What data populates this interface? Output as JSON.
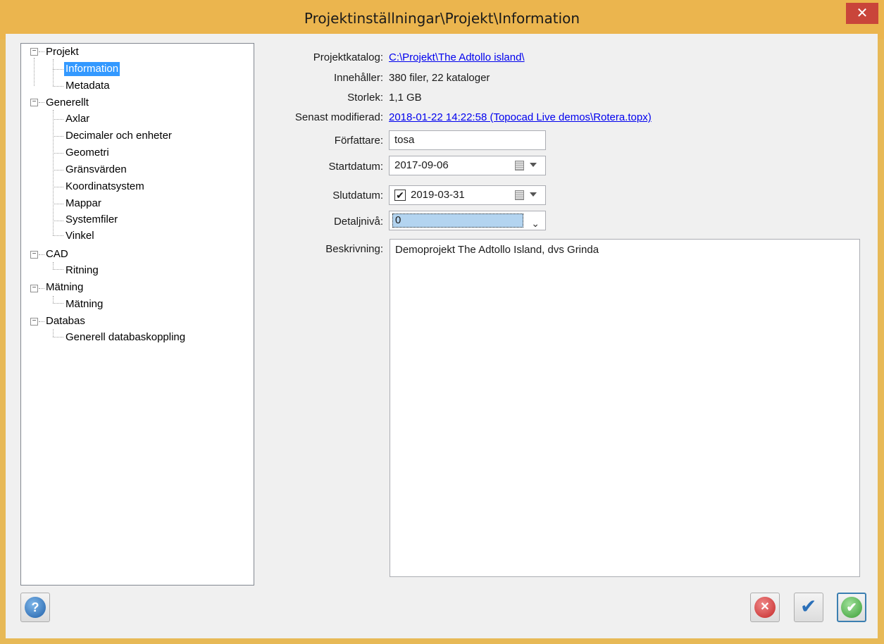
{
  "window": {
    "title": "Projektinställningar\\Projekt\\Information",
    "close_label": "✕"
  },
  "tree": {
    "nodes": [
      {
        "label": "Projekt",
        "level": 0,
        "expanded": true
      },
      {
        "label": "Information",
        "level": 1,
        "selected": true
      },
      {
        "label": "Metadata",
        "level": 1
      },
      {
        "label": "Generellt",
        "level": 0,
        "expanded": true
      },
      {
        "label": "Axlar",
        "level": 1
      },
      {
        "label": "Decimaler och enheter",
        "level": 1
      },
      {
        "label": "Geometri",
        "level": 1
      },
      {
        "label": "Gränsvärden",
        "level": 1
      },
      {
        "label": "Koordinatsystem",
        "level": 1
      },
      {
        "label": "Mappar",
        "level": 1
      },
      {
        "label": "Systemfiler",
        "level": 1
      },
      {
        "label": "Vinkel",
        "level": 1
      },
      {
        "label": "CAD",
        "level": 0,
        "expanded": true
      },
      {
        "label": "Ritning",
        "level": 1
      },
      {
        "label": "Mätning",
        "level": 0,
        "expanded": true
      },
      {
        "label": "Mätning",
        "level": 1
      },
      {
        "label": "Databas",
        "level": 0,
        "expanded": true
      },
      {
        "label": "Generell databaskoppling",
        "level": 1
      }
    ],
    "expander_symbol": "−"
  },
  "info": {
    "projektkatalog_label": "Projektkatalog:",
    "projektkatalog_value": "C:\\Projekt\\The Adtollo island\\",
    "innehaller_label": "Innehåller:",
    "innehaller_value": "380 filer, 22 kataloger",
    "storlek_label": "Storlek:",
    "storlek_value": "1,1 GB",
    "senast_label": "Senast modifierad:",
    "senast_value": "2018-01-22 14:22:58 (Topocad Live demos\\Rotera.topx)",
    "forfattare_label": "Författare:",
    "forfattare_value": "tosa",
    "startdatum_label": "Startdatum:",
    "startdatum_value": "2017-09-06",
    "slutdatum_label": "Slutdatum:",
    "slutdatum_checked": true,
    "slutdatum_value": "2019-03-31",
    "detaljniva_label": "Detaljnivå:",
    "detaljniva_value": "0",
    "beskrivning_label": "Beskrivning:",
    "beskrivning_value": "Demoprojekt The Adtollo Island, dvs Grinda"
  },
  "buttons": {
    "help_symbol": "?",
    "cancel_symbol": "✕",
    "apply_symbol": "✔",
    "ok_symbol": "✔"
  },
  "colors": {
    "title_bar": "#ebb54e",
    "close_button": "#c9453a",
    "selection": "#3399ff",
    "link": "#0000ee"
  }
}
